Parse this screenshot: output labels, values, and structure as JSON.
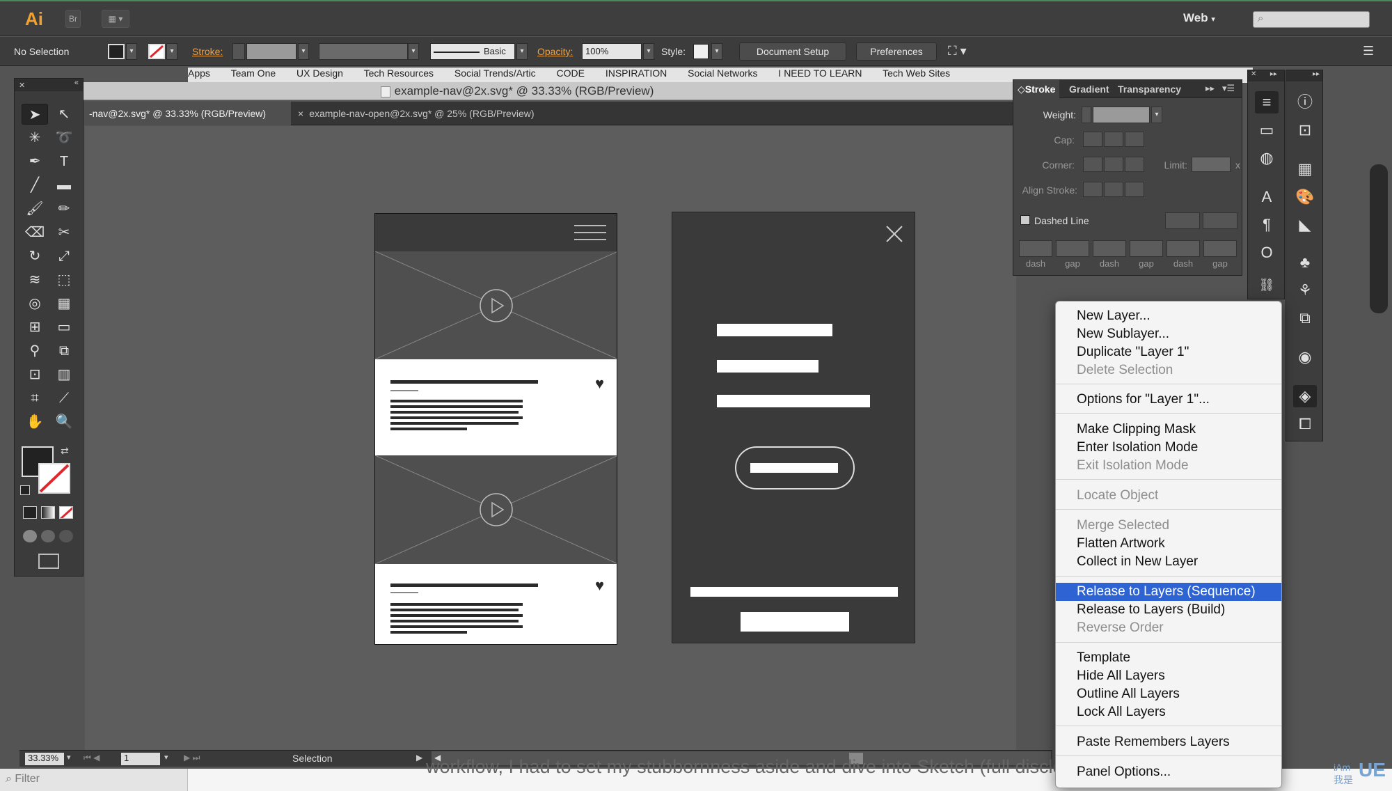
{
  "app": {
    "logo": "Ai",
    "bridge_label": "Br",
    "workspace": "Web",
    "search_placeholder": "",
    "accent": "#f0a030"
  },
  "control_bar": {
    "selection": "No Selection",
    "stroke_label": "Stroke:",
    "brush_label": "Basic",
    "opacity_label": "Opacity:",
    "opacity_value": "100%",
    "style_label": "Style:",
    "document_setup": "Document Setup",
    "preferences": "Preferences"
  },
  "bookmarks": [
    "Apps",
    "Team One",
    "UX Design",
    "Tech Resources",
    "Social Trends/Artic",
    "CODE",
    "INSPIRATION",
    "Social Networks",
    "I NEED TO LEARN",
    "Tech Web Sites"
  ],
  "document": {
    "title": "example-nav@2x.svg* @ 33.33% (RGB/Preview)",
    "tabs": [
      {
        "label": "-nav@2x.svg* @ 33.33% (RGB/Preview)",
        "active": true
      },
      {
        "label": "example-nav-open@2x.svg* @ 25% (RGB/Preview)",
        "active": false
      }
    ]
  },
  "stroke_panel": {
    "tabs": [
      "Stroke",
      "Gradient",
      "Transparency"
    ],
    "weight_label": "Weight:",
    "cap_label": "Cap:",
    "corner_label": "Corner:",
    "limit_label": "Limit:",
    "limit_suffix": "x",
    "align_label": "Align Stroke:",
    "dashed_label": "Dashed Line",
    "dash_labels": [
      "dash",
      "gap",
      "dash",
      "gap",
      "dash",
      "gap"
    ]
  },
  "layers_menu": {
    "groups": [
      [
        {
          "label": "New Layer...",
          "disabled": false
        },
        {
          "label": "New Sublayer...",
          "disabled": false
        },
        {
          "label": "Duplicate \"Layer 1\"",
          "disabled": false
        },
        {
          "label": "Delete Selection",
          "disabled": true
        }
      ],
      [
        {
          "label": "Options for \"Layer 1\"...",
          "disabled": false
        }
      ],
      [
        {
          "label": "Make Clipping Mask",
          "disabled": false
        },
        {
          "label": "Enter Isolation Mode",
          "disabled": false
        },
        {
          "label": "Exit Isolation Mode",
          "disabled": true
        }
      ],
      [
        {
          "label": "Locate Object",
          "disabled": true
        }
      ],
      [
        {
          "label": "Merge Selected",
          "disabled": true
        },
        {
          "label": "Flatten Artwork",
          "disabled": false
        },
        {
          "label": "Collect in New Layer",
          "disabled": false
        }
      ],
      [
        {
          "label": "Release to Layers (Sequence)",
          "disabled": false,
          "highlighted": true
        },
        {
          "label": "Release to Layers (Build)",
          "disabled": false
        },
        {
          "label": "Reverse Order",
          "disabled": true
        }
      ],
      [
        {
          "label": "Template",
          "disabled": false
        },
        {
          "label": "Hide All Layers",
          "disabled": false
        },
        {
          "label": "Outline All Layers",
          "disabled": false
        },
        {
          "label": "Lock All Layers",
          "disabled": false
        }
      ],
      [
        {
          "label": "Paste Remembers Layers",
          "disabled": false
        }
      ],
      [
        {
          "label": "Panel Options...",
          "disabled": false
        }
      ]
    ]
  },
  "status_bar": {
    "zoom": "33.33%",
    "artboard": "1",
    "tool": "Selection"
  },
  "browser_background": {
    "filter_placeholder": "Filter",
    "article_text": "workflow, I had to set my stubbornness aside and dive into Sketch (full disclosu",
    "watermark_top": "iAm",
    "watermark_bottom": "我是",
    "watermark_logo": "UE"
  }
}
